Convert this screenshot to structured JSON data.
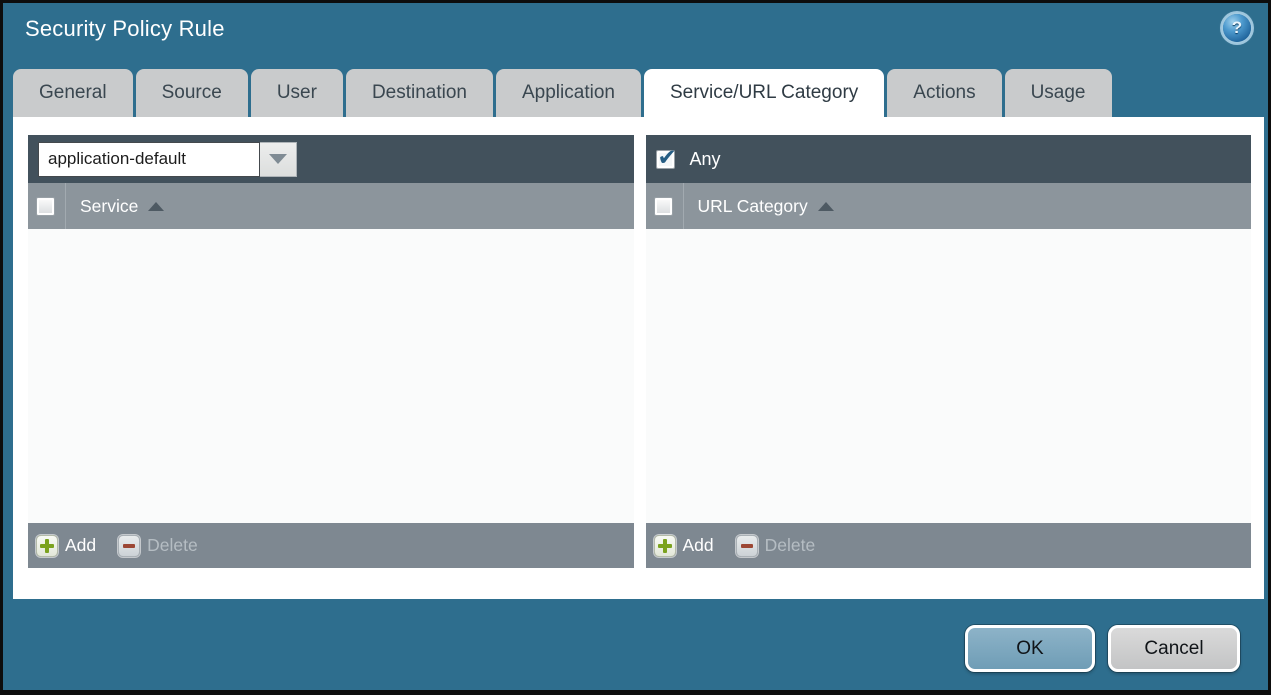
{
  "window": {
    "title": "Security Policy Rule"
  },
  "help": {
    "glyph": "?"
  },
  "tabs": [
    {
      "label": "General",
      "active": false
    },
    {
      "label": "Source",
      "active": false
    },
    {
      "label": "User",
      "active": false
    },
    {
      "label": "Destination",
      "active": false
    },
    {
      "label": "Application",
      "active": false
    },
    {
      "label": "Service/URL Category",
      "active": true
    },
    {
      "label": "Actions",
      "active": false
    },
    {
      "label": "Usage",
      "active": false
    }
  ],
  "service_panel": {
    "dropdown": {
      "value": "application-default"
    },
    "column_header": {
      "label": "Service",
      "checkbox_checked": false,
      "sort": "asc"
    },
    "rows": [],
    "footer": {
      "add_label": "Add",
      "delete_label": "Delete",
      "delete_enabled": false
    }
  },
  "url_category_panel": {
    "any_checkbox": {
      "label": "Any",
      "checked": true
    },
    "column_header": {
      "label": "URL Category",
      "checkbox_checked": false,
      "sort": "asc"
    },
    "rows": [],
    "footer": {
      "add_label": "Add",
      "delete_label": "Delete",
      "delete_enabled": false
    }
  },
  "dialog_buttons": {
    "ok_label": "OK",
    "cancel_label": "Cancel"
  },
  "colors": {
    "dialog_background": "#2e6e8e",
    "panel_header": "#42515c",
    "column_header": "#8c959c",
    "panel_footer": "#7e8891",
    "check_blue": "#255d84",
    "add_green": "#7ba21e",
    "delete_red": "#9c4734",
    "ok_button": "#7fa9c0",
    "cancel_button": "#cecece"
  }
}
